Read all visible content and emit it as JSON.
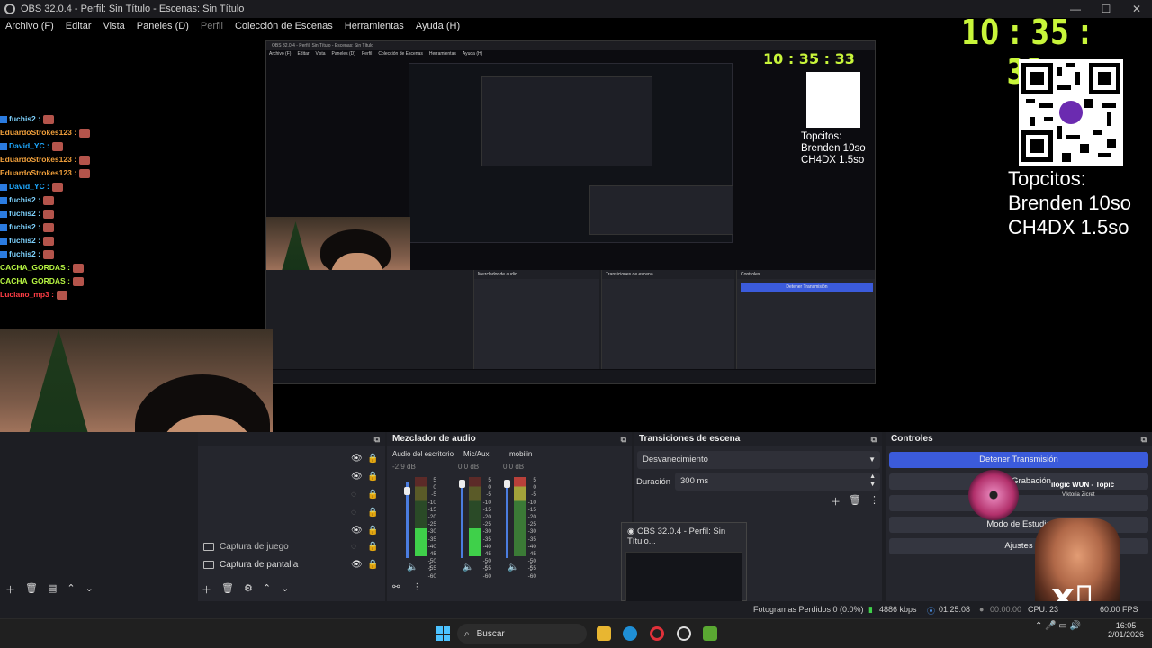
{
  "window": {
    "title": "OBS 32.0.4 - Perfil: Sin Título - Escenas: Sin Título"
  },
  "menubar": [
    "Archivo (F)",
    "Editar",
    "Vista",
    "Paneles (D)",
    "Perfil",
    "Colección de Escenas",
    "Herramientas",
    "Ayuda (H)"
  ],
  "overlay": {
    "clock": "10 : 35 : 33",
    "qr_label": "yape",
    "topcitos": [
      "Topcitos:",
      "Brenden 10so",
      "CH4DX 1.5so"
    ]
  },
  "chat": [
    {
      "user": "fuchis2 :",
      "color": "blue",
      "badges": true
    },
    {
      "user": "EduardoStrokes123 :",
      "color": "orange",
      "badges": false
    },
    {
      "user": "David_YC :",
      "color": "teal",
      "badges": true
    },
    {
      "user": "EduardoStrokes123 :",
      "color": "orange",
      "badges": false
    },
    {
      "user": "EduardoStrokes123 :",
      "color": "orange",
      "badges": false
    },
    {
      "user": "David_YC :",
      "color": "teal",
      "badges": true
    },
    {
      "user": "fuchis2 :",
      "color": "blue",
      "badges": true
    },
    {
      "user": "fuchis2 :",
      "color": "blue",
      "badges": true
    },
    {
      "user": "fuchis2 :",
      "color": "blue",
      "badges": true
    },
    {
      "user": "fuchis2 :",
      "color": "blue",
      "badges": true
    },
    {
      "user": "fuchis2 :",
      "color": "blue",
      "badges": true
    },
    {
      "user": "CACHA_GORDAS :",
      "color": "green",
      "badges": false
    },
    {
      "user": "CACHA_GORDAS :",
      "color": "green",
      "badges": false
    },
    {
      "user": "Luciano_mp3 :",
      "color": "red",
      "badges": false
    }
  ],
  "nested": {
    "title": "OBS 32.0.4 - Perfil: Sin Título - Escenas: Sin Título",
    "menu": [
      "Archivo (F)",
      "Editar",
      "Vista",
      "Paneles (D)",
      "Perfil",
      "Colección de Escenas",
      "Herramientas",
      "Ayuda (H)"
    ],
    "clock": "10 : 35 : 33",
    "topcitos": [
      "Topcitos:",
      "Brenden 10so",
      "CH4DX 1.5so"
    ]
  },
  "sources": {
    "items": [
      {
        "label": "Captura de juego",
        "visible": false
      },
      {
        "label": "Captura de pantalla",
        "visible": true
      }
    ]
  },
  "mixer": {
    "title": "Mezclador de audio",
    "channels": [
      {
        "name": "Audio del escritorio",
        "db": "-2.9 dB",
        "level": 0.35
      },
      {
        "name": "Mic/Aux",
        "db": "0.0 dB",
        "level": 0.35
      },
      {
        "name": "mobilin",
        "db": "0.0 dB",
        "level": 0.0
      }
    ],
    "scale": [
      "5",
      "0",
      "-5",
      "-10",
      "-15",
      "-20",
      "-25",
      "-30",
      "-35",
      "-40",
      "-45",
      "-50",
      "-55",
      "-60"
    ]
  },
  "transitions": {
    "title": "Transiciones de escena",
    "selected": "Desvanecimiento",
    "duration_label": "Duración",
    "duration_value": "300 ms"
  },
  "controls": {
    "title": "Controles",
    "buttons": [
      "Detener Transmisión",
      "Iniciar Grabación",
      "Modo de Estudio",
      "Ajustes"
    ]
  },
  "preview_popup": {
    "title": "OBS 32.0.4 - Perfil: Sin Título..."
  },
  "song": {
    "title": "ilogic WUN - Topic",
    "artist": "Viktoria Zicret"
  },
  "status": {
    "dropped": "Fotogramas Perdidos 0 (0.0%)",
    "bitrate": "4886 kbps",
    "live_time": "01:25:08",
    "rec_time": "00:00:00",
    "cpu": "CPU: 23",
    "fps": "60.00 FPS"
  },
  "taskbar": {
    "search_placeholder": "Buscar",
    "time": "16:05",
    "date": "2/01/2026"
  },
  "colors": {
    "clock": "#c8f53a",
    "stream_button": "#3b5bdb",
    "meter_green": "#3fd04a"
  }
}
